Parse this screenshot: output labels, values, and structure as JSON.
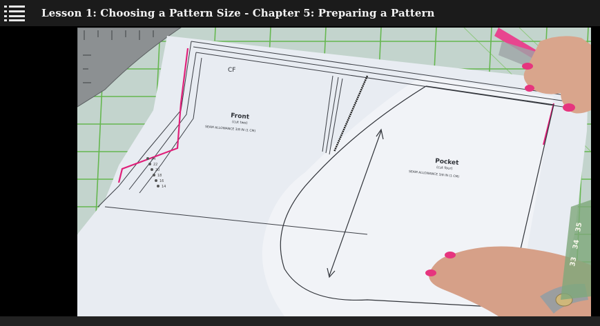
{
  "header": {
    "title": "Lesson 1: Choosing a Pattern Size - Chapter 5: Preparing a Pattern",
    "menu_icon": "list-icon"
  },
  "video": {
    "pattern_front": {
      "title": "Front",
      "cut_note": "(cut two)",
      "seam": "SEAM ALLOWANCE 3/8 IN (1 CM)",
      "cf_label": "CF",
      "size_marks": [
        "24",
        "22",
        "20",
        "18",
        "16",
        "14"
      ]
    },
    "pattern_pocket": {
      "title": "Pocket",
      "cut_note": "(cut four)",
      "seam": "SEAM ALLOWANCE 3/8 IN (1 CM)"
    },
    "ruler_marks": [
      "33",
      "34",
      "35"
    ],
    "colors": {
      "mat": "#bfd2cc",
      "grid": "#4caf2e",
      "paper": "#e9edf3",
      "highlight": "#e0207a"
    }
  }
}
